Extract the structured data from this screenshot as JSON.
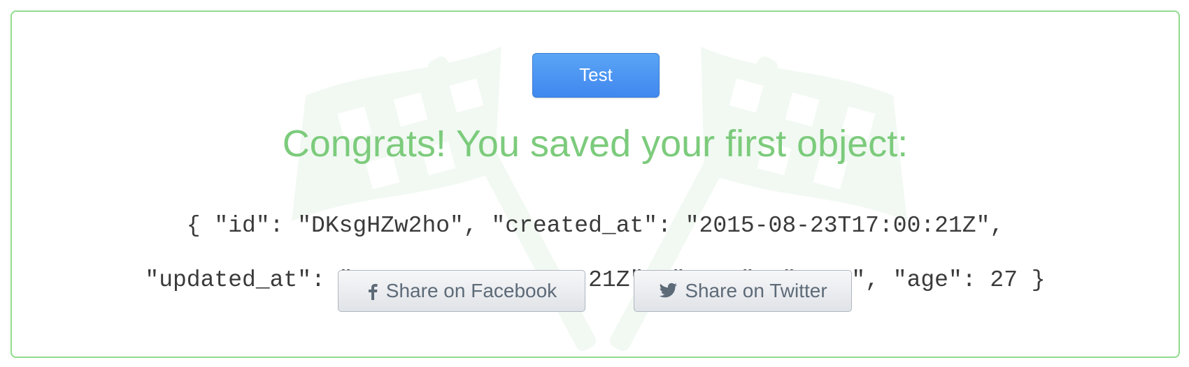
{
  "test_button": {
    "label": "Test"
  },
  "message": {
    "congrats": "Congrats! You saved your first object:"
  },
  "saved_object": {
    "line1": "{ \"id\": \"DKsgHZw2ho\", \"created_at\": \"2015-08-23T17:00:21Z\",",
    "line2": "\"updated_at\": \"2015-08-23T17:00:21Z\", \"name\": \"moco\", \"age\": 27 }"
  },
  "share": {
    "facebook_label": "Share on Facebook",
    "twitter_label": "Share on Twitter",
    "facebook_icon": "facebook-icon",
    "twitter_icon": "twitter-icon"
  },
  "colors": {
    "border": "#8fdc8f",
    "congrats_text": "#7ccb7c",
    "test_button": "#4a90f0",
    "share_text": "#5d6a78"
  }
}
